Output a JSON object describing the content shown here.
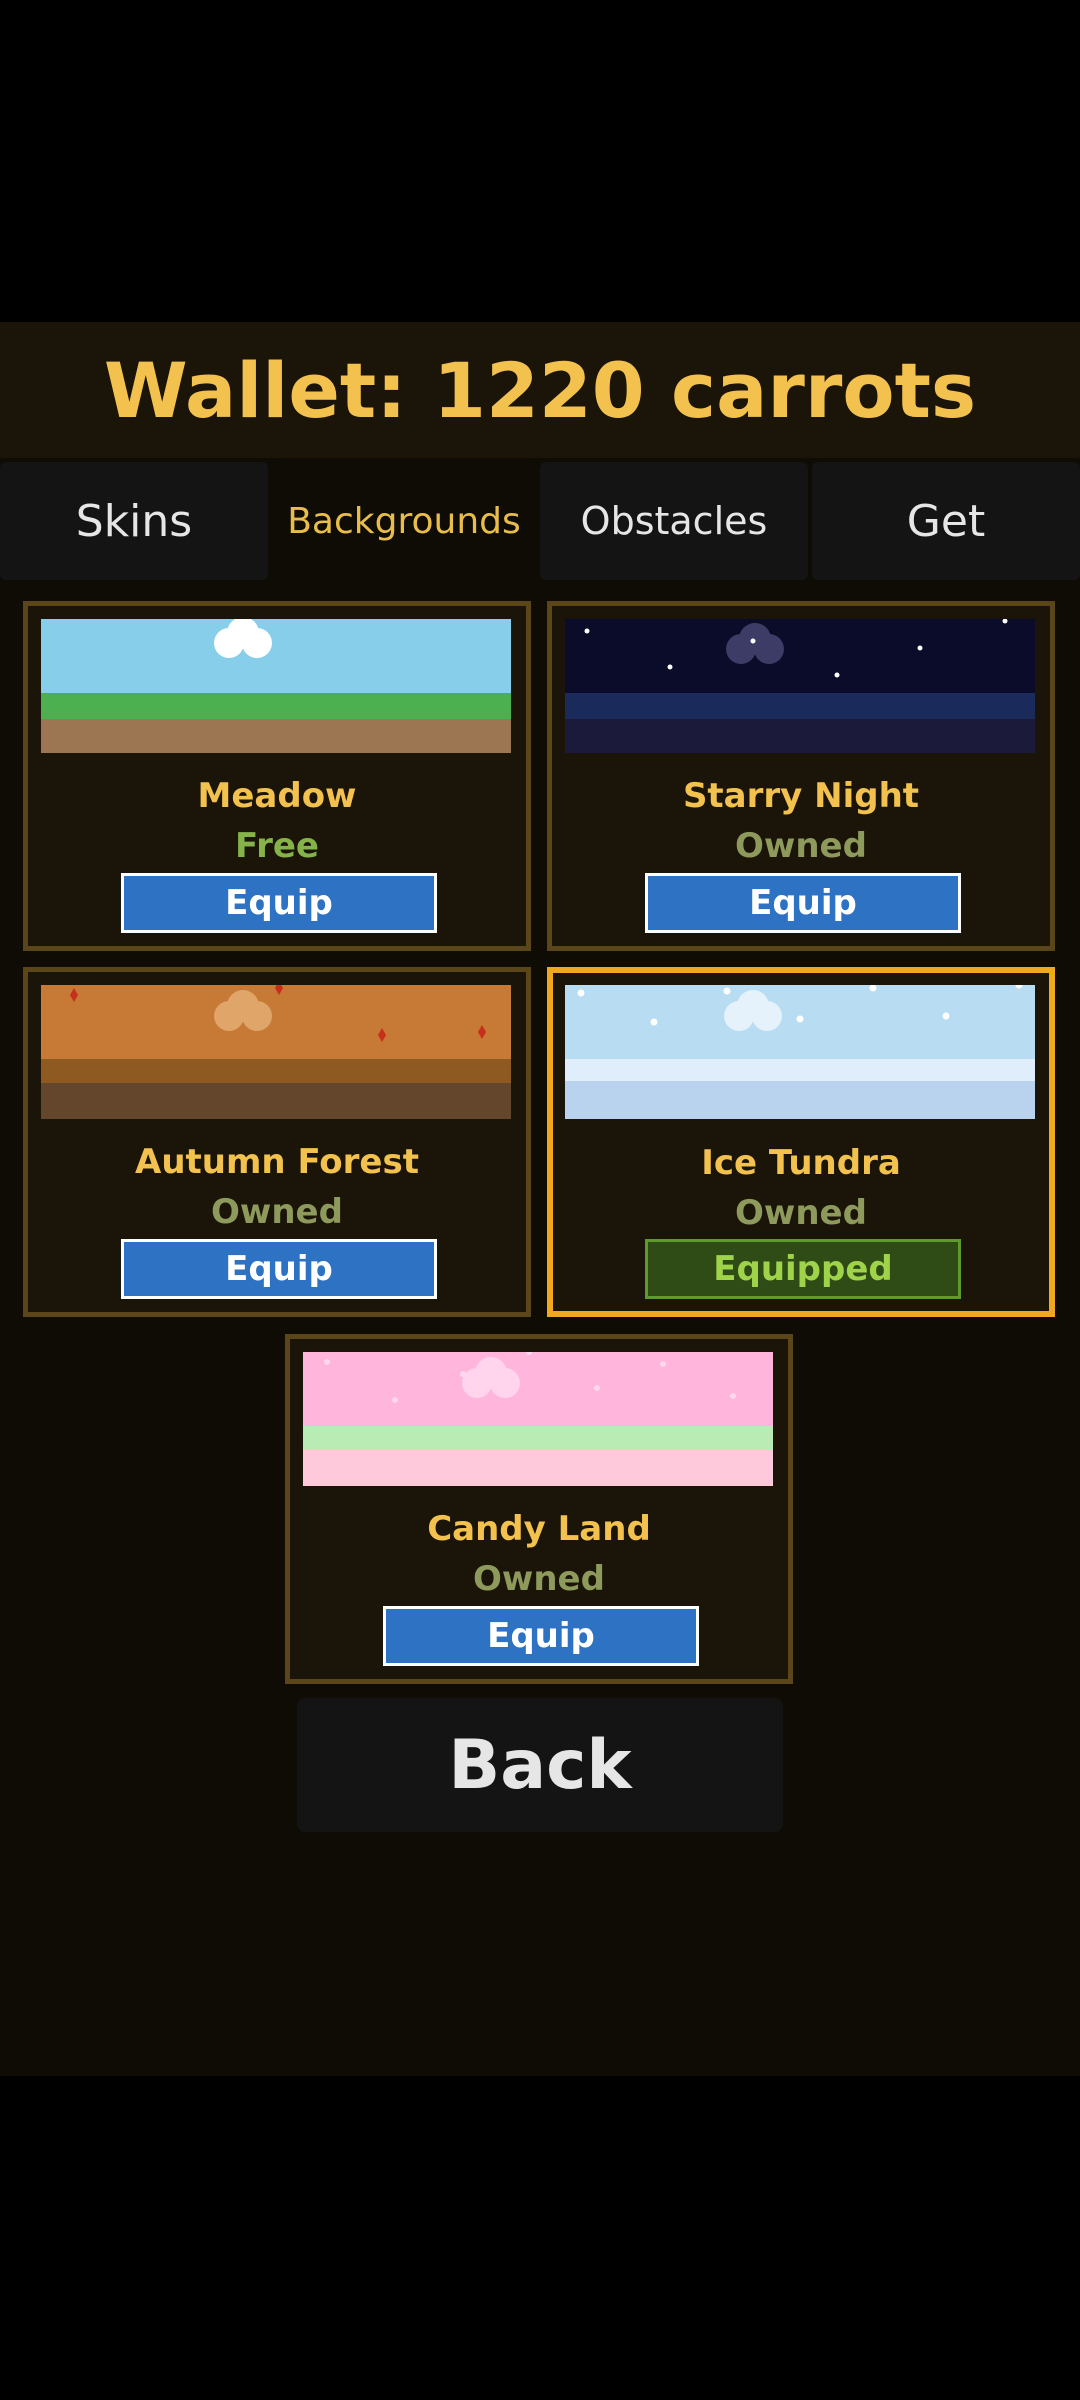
{
  "wallet": {
    "text": "Wallet: 1220 carrots"
  },
  "tabs": [
    {
      "label": "Skins",
      "active": false
    },
    {
      "label": "Backgrounds",
      "active": true
    },
    {
      "label": "Obstacles",
      "active": false
    },
    {
      "label": "Get",
      "active": false
    }
  ],
  "backgrounds": [
    {
      "name": "Meadow",
      "status": "Free",
      "button": "Equip",
      "equipped": false
    },
    {
      "name": "Starry Night",
      "status": "Owned",
      "button": "Equip",
      "equipped": false
    },
    {
      "name": "Autumn Forest",
      "status": "Owned",
      "button": "Equip",
      "equipped": false
    },
    {
      "name": "Ice Tundra",
      "status": "Owned",
      "button": "Equipped",
      "equipped": true
    },
    {
      "name": "Candy Land",
      "status": "Owned",
      "button": "Equip",
      "equipped": false
    }
  ],
  "back_button": {
    "label": "Back"
  },
  "colors": {
    "accent": "#f2c14e",
    "equip_button": "#2e72c4",
    "equipped_button": "#2f4c16",
    "selected_border": "#f0a81e"
  }
}
